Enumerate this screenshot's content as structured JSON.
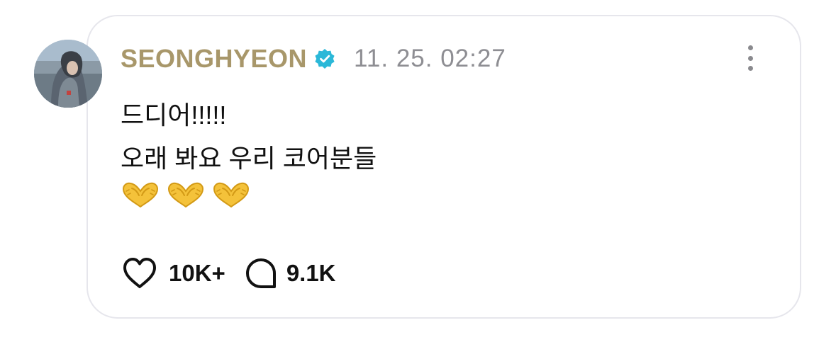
{
  "post": {
    "author": "SEONGHYEON",
    "verified_icon": "verified-badge-icon",
    "timestamp": "11. 25. 02:27",
    "body_lines": [
      "드디어!!!!!",
      "오래 봐요 우리 코어분들"
    ],
    "emoji": [
      "heart-hands-emoji",
      "heart-hands-emoji",
      "heart-hands-emoji"
    ]
  },
  "actions": {
    "like_icon": "heart-outline-icon",
    "like_count": "10K+",
    "comment_icon": "speech-bubble-icon",
    "comment_count": "9.1K",
    "more_icon": "vertical-ellipsis-icon"
  },
  "colors": {
    "author_name": "#a8976a",
    "verified": "#2bb8d8",
    "timestamp": "#8e8e93",
    "card_border": "#e6e6ec"
  }
}
